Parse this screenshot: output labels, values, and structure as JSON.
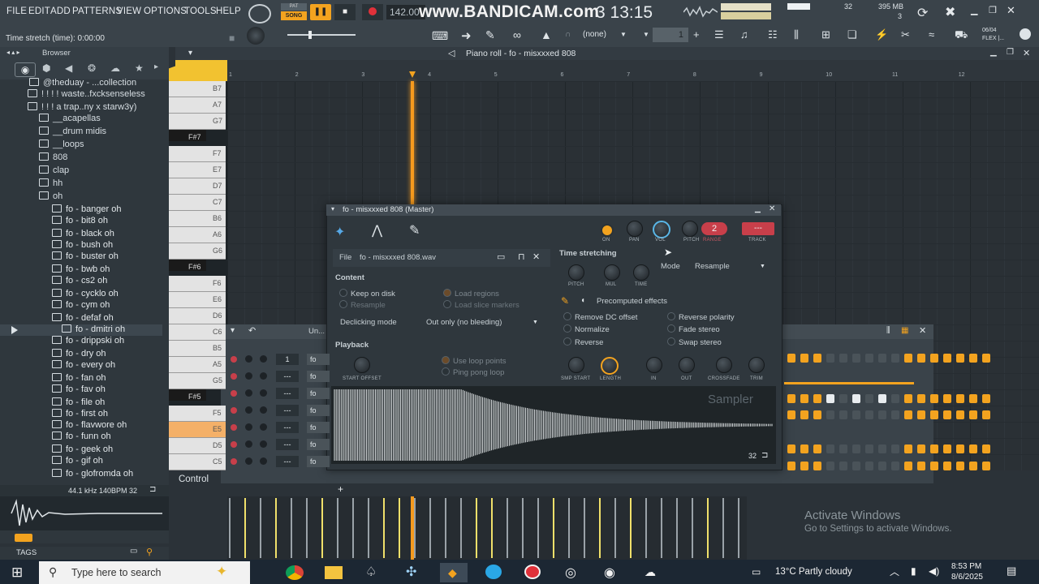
{
  "menu": {
    "items": [
      "FILE",
      "EDIT",
      "ADD",
      "PATTERNS",
      "VIEW",
      "OPTIONS",
      "TOOLS",
      "HELP"
    ],
    "song_label": "SONG",
    "pat_label": "PAT",
    "tempo": "142.00",
    "watermark": "www.BANDICAM.com",
    "time": "3 13:15",
    "cpu_count": "32",
    "memory": "395 MB",
    "poly": "3",
    "flex_date": "06/04",
    "flex_label": "FLEX |..."
  },
  "hint": {
    "text": "Time stretch (time): 0:00:00",
    "snap": "(none)",
    "pattern_num": "1"
  },
  "browser": {
    "title": "Browser",
    "items": [
      {
        "label": "@theduay - ...collection",
        "type": "folder"
      },
      {
        "label": "! ! ! ! waste..fxcksenseless",
        "type": "folder"
      },
      {
        "label": "! ! ! a trap..ny x starw3y)",
        "type": "folder"
      },
      {
        "label": "__acapellas",
        "type": "folder"
      },
      {
        "label": "__drum midis",
        "type": "folder"
      },
      {
        "label": "__loops",
        "type": "folder"
      },
      {
        "label": "808",
        "type": "folder"
      },
      {
        "label": "clap",
        "type": "folder"
      },
      {
        "label": "hh",
        "type": "folder"
      },
      {
        "label": "oh",
        "type": "folder"
      },
      {
        "label": "fo - banger oh",
        "type": "file"
      },
      {
        "label": "fo - bit8 oh",
        "type": "file"
      },
      {
        "label": "fo - black oh",
        "type": "file"
      },
      {
        "label": "fo - bush oh",
        "type": "file"
      },
      {
        "label": "fo - buster oh",
        "type": "file"
      },
      {
        "label": "fo - bwb oh",
        "type": "file"
      },
      {
        "label": "fo - cs2 oh",
        "type": "file"
      },
      {
        "label": "fo - cycklo oh",
        "type": "file"
      },
      {
        "label": "fo - cym oh",
        "type": "file"
      },
      {
        "label": "fo - defaf oh",
        "type": "file"
      },
      {
        "label": "fo - dmitri oh",
        "type": "file"
      },
      {
        "label": "fo - drippski oh",
        "type": "file"
      },
      {
        "label": "fo - dry oh",
        "type": "file"
      },
      {
        "label": "fo - every oh",
        "type": "file"
      },
      {
        "label": "fo - fan oh",
        "type": "file"
      },
      {
        "label": "fo - fav oh",
        "type": "file"
      },
      {
        "label": "fo - file oh",
        "type": "file"
      },
      {
        "label": "fo - first oh",
        "type": "file"
      },
      {
        "label": "fo - flavwore oh",
        "type": "file"
      },
      {
        "label": "fo - funn oh",
        "type": "file"
      },
      {
        "label": "fo - geek oh",
        "type": "file"
      },
      {
        "label": "fo - gif oh",
        "type": "file"
      },
      {
        "label": "fo - glofromda oh",
        "type": "file"
      }
    ],
    "preview_info": "44.1 kHz 140BPM 32",
    "tags_label": "TAGS"
  },
  "piano_roll": {
    "title": "Piano roll - fo - misxxxed 808",
    "ruler": [
      "1",
      "2",
      "3",
      "4",
      "5",
      "6",
      "7",
      "8",
      "9",
      "10",
      "11",
      "12"
    ],
    "notes": [
      "B7",
      "A7",
      "G7",
      "F#7",
      "F7",
      "E7",
      "D7",
      "C7",
      "B6",
      "A6",
      "G6",
      "F#6",
      "F6",
      "E6",
      "D6",
      "C6",
      "B5",
      "A5",
      "G5",
      "F#5",
      "F5",
      "E5",
      "D5",
      "C5"
    ]
  },
  "sampler": {
    "title": "fo - misxxxed 808 (Master)",
    "knob_labels": [
      "ON",
      "PAN",
      "VOL",
      "PITCH",
      "RANGE",
      "TRACK"
    ],
    "range_value": "2",
    "track_value": "---",
    "file_label": "File",
    "file_name": "fo - misxxxed 808.wav",
    "content_label": "Content",
    "keep_on_disk": "Keep on disk",
    "resample": "Resample",
    "load_regions": "Load regions",
    "load_slice_markers": "Load slice markers",
    "declicking_label": "Declicking mode",
    "declicking_value": "Out only (no bleeding)",
    "playback_label": "Playback",
    "use_loop_points": "Use loop points",
    "ping_pong_loop": "Ping pong loop",
    "start_offset": "START OFFSET",
    "time_stretching_label": "Time stretching",
    "ts_knobs": [
      "PITCH",
      "MUL",
      "TIME"
    ],
    "mode_label": "Mode",
    "mode_value": "Resample",
    "precomputed_label": "Precomputed effects",
    "effects_left": [
      "Remove DC offset",
      "Normalize",
      "Reverse"
    ],
    "effects_right": [
      "Reverse polarity",
      "Fade stereo",
      "Swap stereo"
    ],
    "bottom_knobs": [
      "SMP START",
      "LENGTH",
      "IN",
      "OUT",
      "CROSSFADE",
      "TRIM"
    ],
    "watermark": "Sampler",
    "waveform_zoom": "32"
  },
  "rack": {
    "title": "Un...",
    "control_label": "Control",
    "channels": [
      {
        "num": "1",
        "name": "fo"
      },
      {
        "num": "---",
        "name": "fo"
      },
      {
        "num": "---",
        "name": "fo"
      },
      {
        "num": "---",
        "name": "fo"
      },
      {
        "num": "---",
        "name": "fo"
      },
      {
        "num": "---",
        "name": "fo"
      },
      {
        "num": "---",
        "name": "fo"
      }
    ]
  },
  "activation": {
    "title": "Activate Windows",
    "subtitle": "Go to Settings to activate Windows."
  },
  "taskbar": {
    "search_placeholder": "Type here to search",
    "weather": "13°C  Partly cloudy",
    "clock_time": "8:53 PM",
    "clock_date": "8/6/2025"
  }
}
